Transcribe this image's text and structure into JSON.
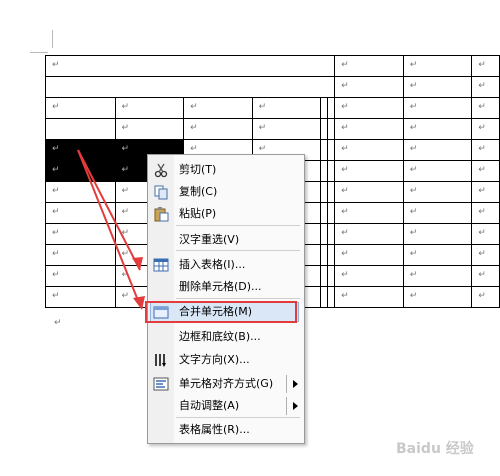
{
  "cell_mark": "↵",
  "table_rows": [
    {
      "cells": [
        {
          "span": 6,
          "text": "↵"
        },
        {
          "span": 1,
          "text": "↵"
        },
        {
          "span": 1,
          "text": "↵"
        },
        {
          "span": 1,
          "text": "↵"
        }
      ]
    },
    {
      "cells": [
        {
          "span": 6,
          "text": ""
        },
        {
          "span": 1,
          "text": "↵"
        },
        {
          "span": 1,
          "text": "↵"
        },
        {
          "span": 1,
          "text": "↵"
        }
      ]
    },
    {
      "cells": [
        {
          "text": "↵"
        },
        {
          "text": "↵"
        },
        {
          "text": "↵"
        },
        {
          "text": "↵"
        },
        {
          "text": ""
        },
        {
          "text": ""
        },
        {
          "text": "↵"
        },
        {
          "text": "↵"
        },
        {
          "text": "↵"
        }
      ]
    },
    {
      "cells": [
        {
          "text": ""
        },
        {
          "text": "↵"
        },
        {
          "text": "↵"
        },
        {
          "text": "↵"
        },
        {
          "text": ""
        },
        {
          "text": ""
        },
        {
          "text": "↵"
        },
        {
          "text": "↵"
        },
        {
          "text": "↵"
        }
      ]
    },
    {
      "cells": [
        {
          "text": "↵",
          "sel": true
        },
        {
          "text": "↵",
          "sel": true
        },
        {
          "text": "↵"
        },
        {
          "text": "↵"
        },
        {
          "text": ""
        },
        {
          "text": ""
        },
        {
          "text": "↵"
        },
        {
          "text": "↵"
        },
        {
          "text": "↵"
        }
      ]
    },
    {
      "cells": [
        {
          "text": "↵",
          "sel": true
        },
        {
          "text": "↵",
          "sel": true
        },
        {
          "text": ""
        },
        {
          "text": ""
        },
        {
          "text": ""
        },
        {
          "text": ""
        },
        {
          "text": "↵"
        },
        {
          "text": "↵"
        },
        {
          "text": "↵"
        }
      ]
    },
    {
      "cells": [
        {
          "text": "↵"
        },
        {
          "text": "↵"
        },
        {
          "text": ""
        },
        {
          "text": ""
        },
        {
          "text": ""
        },
        {
          "text": ""
        },
        {
          "text": "↵"
        },
        {
          "text": "↵"
        },
        {
          "text": "↵"
        }
      ]
    },
    {
      "cells": [
        {
          "text": "↵"
        },
        {
          "text": "↵"
        },
        {
          "text": ""
        },
        {
          "text": ""
        },
        {
          "text": ""
        },
        {
          "text": ""
        },
        {
          "text": "↵"
        },
        {
          "text": "↵"
        },
        {
          "text": "↵"
        }
      ]
    },
    {
      "cells": [
        {
          "text": "↵"
        },
        {
          "text": "↵"
        },
        {
          "text": ""
        },
        {
          "text": ""
        },
        {
          "text": ""
        },
        {
          "text": ""
        },
        {
          "text": "↵"
        },
        {
          "text": "↵"
        },
        {
          "text": "↵"
        }
      ]
    },
    {
      "cells": [
        {
          "text": "↵"
        },
        {
          "text": "↵"
        },
        {
          "text": ""
        },
        {
          "text": ""
        },
        {
          "text": ""
        },
        {
          "text": ""
        },
        {
          "text": "↵"
        },
        {
          "text": "↵"
        },
        {
          "text": "↵"
        }
      ]
    },
    {
      "cells": [
        {
          "text": "↵"
        },
        {
          "text": "↵"
        },
        {
          "text": ""
        },
        {
          "text": ""
        },
        {
          "text": ""
        },
        {
          "text": ""
        },
        {
          "text": "↵"
        },
        {
          "text": "↵"
        },
        {
          "text": "↵"
        }
      ]
    },
    {
      "cells": [
        {
          "text": "↵"
        },
        {
          "text": "↵"
        },
        {
          "text": ""
        },
        {
          "text": ""
        },
        {
          "text": ""
        },
        {
          "text": ""
        },
        {
          "text": "↵"
        },
        {
          "text": "↵"
        },
        {
          "text": "↵"
        }
      ]
    }
  ],
  "context_menu": {
    "items": [
      {
        "label": "剪切(T)",
        "icon": "scissors-icon"
      },
      {
        "label": "复制(C)",
        "icon": "copy-icon"
      },
      {
        "label": "粘贴(P)",
        "icon": "paste-icon"
      },
      {
        "label": "汉字重选(V)",
        "icon": ""
      },
      {
        "label": "插入表格(I)...",
        "icon": "insert-table-icon"
      },
      {
        "label": "删除单元格(D)...",
        "icon": ""
      },
      {
        "label": "合并单元格(M)",
        "icon": "merge-cells-icon",
        "highlighted": true
      },
      {
        "label": "边框和底纹(B)...",
        "icon": ""
      },
      {
        "label": "文字方向(X)...",
        "icon": "text-direction-icon"
      },
      {
        "label": "单元格对齐方式(G)",
        "icon": "cell-align-icon",
        "submenu": true
      },
      {
        "label": "自动调整(A)",
        "icon": "",
        "submenu": true
      },
      {
        "label": "表格属性(R)...",
        "icon": ""
      }
    ]
  },
  "colors": {
    "highlight_box": "#e23c3c",
    "arrow": "#e23c3c",
    "menu_highlight": "#d9e7f7",
    "selection": "#000000"
  },
  "watermark": "Baidu 经验"
}
